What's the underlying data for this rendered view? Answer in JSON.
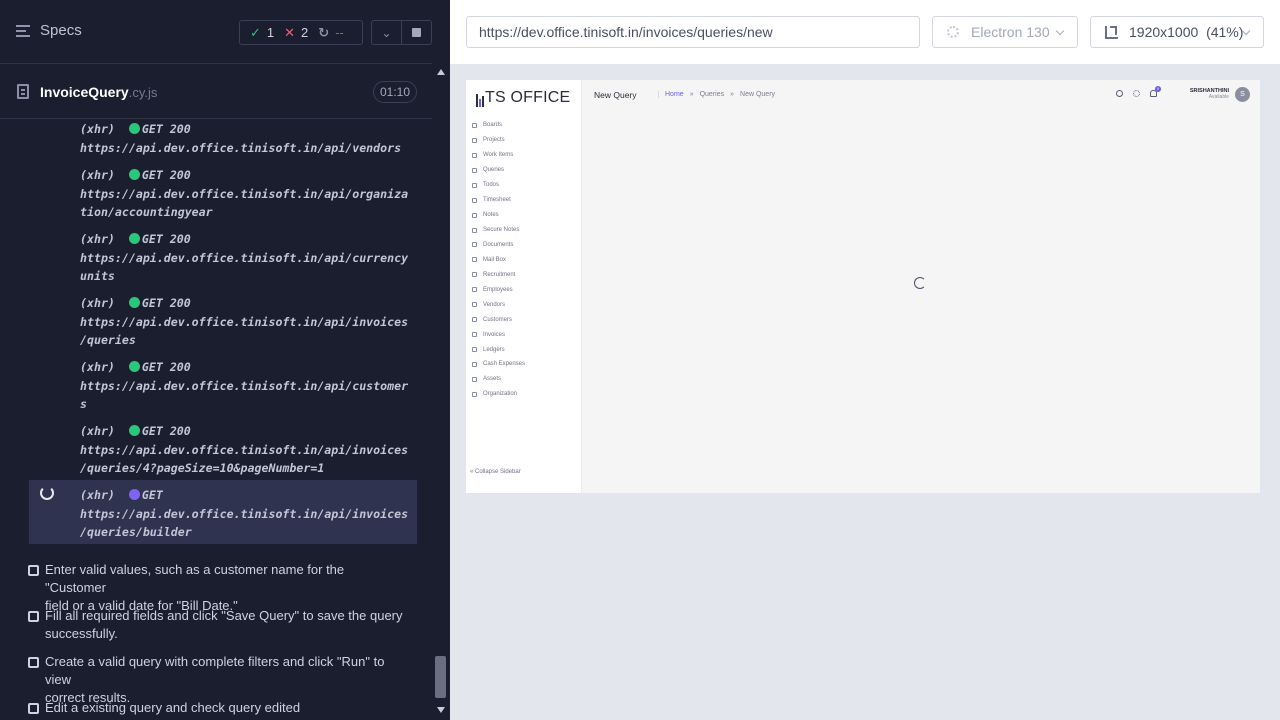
{
  "runner": {
    "specs_label": "Specs",
    "stats": {
      "passed": "1",
      "failed": "2",
      "pending": "--"
    },
    "spec": {
      "name": "InvoiceQuery",
      "ext": ".cy.js",
      "time": "01:10"
    },
    "commands": [
      {
        "kind": "(xhr)",
        "method": "GET 200",
        "url_line1": "https://api.dev.office.tinisoft.in/api/vendors",
        "url_line2": "",
        "status": "green"
      },
      {
        "kind": "(xhr)",
        "method": "GET 200",
        "url_line1": "https://api.dev.office.tinisoft.in/api/organiza",
        "url_line2": "tion/accountingyear",
        "status": "green"
      },
      {
        "kind": "(xhr)",
        "method": "GET 200",
        "url_line1": "https://api.dev.office.tinisoft.in/api/currency",
        "url_line2": "units",
        "status": "green"
      },
      {
        "kind": "(xhr)",
        "method": "GET 200",
        "url_line1": "https://api.dev.office.tinisoft.in/api/invoices",
        "url_line2": "/queries",
        "status": "green"
      },
      {
        "kind": "(xhr)",
        "method": "GET 200",
        "url_line1": "https://api.dev.office.tinisoft.in/api/customer",
        "url_line2": "s",
        "status": "green"
      },
      {
        "kind": "(xhr)",
        "method": "GET 200",
        "url_line1": "https://api.dev.office.tinisoft.in/api/invoices",
        "url_line2": "/queries/4?pageSize=10&pageNumber=1",
        "status": "green"
      },
      {
        "kind": "(xhr)",
        "method": "GET",
        "url_line1": "https://api.dev.office.tinisoft.in/api/invoices",
        "url_line2": "/queries/builder",
        "status": "purple"
      }
    ],
    "tests": [
      {
        "line1": "Enter valid values, such as a customer name for the \"Customer",
        "line2": "field or a valid date for \"Bill Date.\""
      },
      {
        "line1": "Fill all required fields and click \"Save Query\" to save the query",
        "line2": "successfully."
      },
      {
        "line1": "Create a valid query with complete filters and click \"Run\" to view",
        "line2": "correct results."
      },
      {
        "line1": "Edit a existing query and check query edited",
        "line2": ""
      }
    ]
  },
  "browser": {
    "url": "https://dev.office.tinisoft.in/invoices/queries/new",
    "browser_name": "Electron 130",
    "viewport": "1920x1000  (41%)"
  },
  "app": {
    "logo_text": "TS OFFICE",
    "page_title": "New Query",
    "breadcrumbs": [
      "Home",
      "»",
      "Queries",
      "»",
      "New Query"
    ],
    "nav": [
      "Boards",
      "Projects",
      "Work Items",
      "Queries",
      "Todos",
      "Timesheet",
      "Notes",
      "Secure Notes",
      "Documents",
      "Mail Box",
      "Recruitment",
      "Employees",
      "Vendors",
      "Customers",
      "Invoices",
      "Ledgers",
      "Cash Expenses",
      "Assets",
      "Organization"
    ],
    "collapse_label": "« Collapse Sidebar",
    "notifications": "0",
    "user_name": "SRISHANTHINI",
    "user_status": "Available",
    "avatar_letter": "S"
  },
  "colors": {
    "pass": "#27c87a",
    "fail": "#f05c75",
    "running": "#7f63f5",
    "brand": "#6a5cf0"
  }
}
